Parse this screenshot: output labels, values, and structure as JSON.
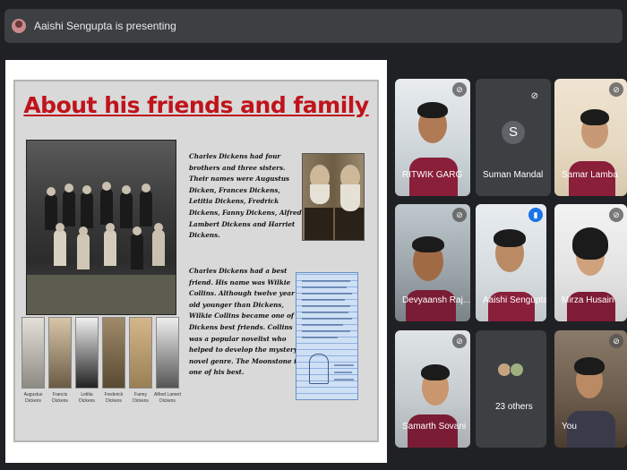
{
  "presenter": {
    "text": "Aaishi Sengupta is presenting"
  },
  "slide": {
    "title": "About his friends and family",
    "paragraph1": "Charles Dickens had four brothers and three sisters. Their names were Augustus Dicken, Frances Dickens, Letitia Dickens, Fredrick Dickens, Fanny Dickens, Alfred Lambert Dickens and Harriet Dickens.",
    "paragraph2": "Charles Dickens had a best friend. His name was Wilkie Collins. Although twelve year old younger than Dickens, Wilkie Collins became one of Dickens best friends. Collins was a popular novelist who helped to develop the mystery novel genre. The Moonstone is one of his best.",
    "portrait_labels": [
      "Augustus Dickens",
      "Francis Dickens",
      "Letitia Dickens",
      "Frederick Dickens",
      "Fanny Dickens",
      "Alfred Lamert Dickens"
    ]
  },
  "participants": [
    {
      "name": "RITWIK GARG"
    },
    {
      "name": "Suman Mandal",
      "avatar_letter": "S"
    },
    {
      "name": "Samar Lamba"
    },
    {
      "name": "Devyaansh Raj..."
    },
    {
      "name": "Aaishi Sengupta"
    },
    {
      "name": "Mirza Husain"
    },
    {
      "name": "Samarth Sovani"
    },
    {
      "name": "23 others"
    },
    {
      "name": "You"
    }
  ],
  "icons": {
    "mic_off": "mic-off-icon",
    "mic_active": "mic-active-icon"
  },
  "colors": {
    "title_red": "#c0131b",
    "tile_bg": "#3c4043",
    "active_blue": "#1a73e8"
  }
}
